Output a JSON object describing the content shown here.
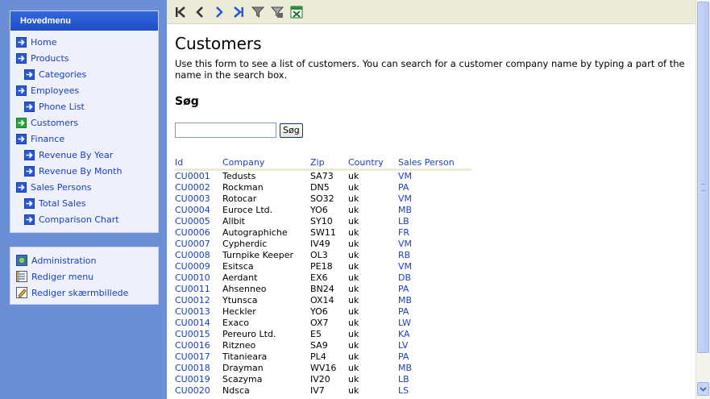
{
  "sidebar": {
    "header": "Hovedmenu",
    "menu": [
      {
        "label": "Home",
        "level": 0,
        "icon": "arrow-right-icon"
      },
      {
        "label": "Products",
        "level": 0,
        "icon": "arrow-right-icon"
      },
      {
        "label": "Categories",
        "level": 1,
        "icon": "arrow-right-icon"
      },
      {
        "label": "Employees",
        "level": 0,
        "icon": "arrow-right-icon"
      },
      {
        "label": "Phone List",
        "level": 1,
        "icon": "arrow-right-icon"
      },
      {
        "label": "Customers",
        "level": 0,
        "icon": "arrow-right-green-icon",
        "active": true
      },
      {
        "label": "Finance",
        "level": 0,
        "icon": "arrow-right-icon"
      },
      {
        "label": "Revenue By Year",
        "level": 1,
        "icon": "arrow-right-icon"
      },
      {
        "label": "Revenue By Month",
        "level": 1,
        "icon": "arrow-right-icon"
      },
      {
        "label": "Sales Persons",
        "level": 0,
        "icon": "arrow-right-icon"
      },
      {
        "label": "Total Sales",
        "level": 1,
        "icon": "arrow-right-icon"
      },
      {
        "label": "Comparison Chart",
        "level": 1,
        "icon": "arrow-right-icon"
      }
    ],
    "admin": [
      {
        "label": "Administration",
        "icon": "administration-icon"
      },
      {
        "label": "Rediger menu",
        "icon": "edit-menu-icon"
      },
      {
        "label": "Rediger skærmbillede",
        "icon": "edit-screen-icon"
      }
    ]
  },
  "toolbar": {
    "buttons": [
      "first-page-icon",
      "previous-page-icon",
      "next-page-icon",
      "last-page-icon",
      "filter-icon",
      "clear-filter-icon",
      "excel-export-icon"
    ]
  },
  "page": {
    "title": "Customers",
    "description": "Use this form to see a list of customers. You can search for a customer company name by typing a part of the name in the search box.",
    "search_heading": "Søg",
    "search_value": "",
    "search_button": "Søg"
  },
  "table": {
    "headers": [
      "Id",
      "Company",
      "Zip",
      "Country",
      "Sales Person"
    ],
    "rows": [
      [
        "CU0001",
        "Tedusts",
        "SA73",
        "uk",
        "VM"
      ],
      [
        "CU0002",
        "Rockman",
        "DN5",
        "uk",
        "PA"
      ],
      [
        "CU0003",
        "Rotocar",
        "SO32",
        "uk",
        "VM"
      ],
      [
        "CU0004",
        "Eurocе Ltd.",
        "YO6",
        "uk",
        "MB"
      ],
      [
        "CU0005",
        "Allbit",
        "SY10",
        "uk",
        "LB"
      ],
      [
        "CU0006",
        "Autographiche",
        "SW11",
        "uk",
        "FR"
      ],
      [
        "CU0007",
        "Cypherdic",
        "IV49",
        "uk",
        "VM"
      ],
      [
        "CU0008",
        "Turnpike Keeper",
        "OL3",
        "uk",
        "RB"
      ],
      [
        "CU0009",
        "Esitsca",
        "PE18",
        "uk",
        "VM"
      ],
      [
        "CU0010",
        "Aerdant",
        "EX6",
        "uk",
        "DB"
      ],
      [
        "CU0011",
        "Ahsenneo",
        "BN24",
        "uk",
        "PA"
      ],
      [
        "CU0012",
        "Ytunsca",
        "OX14",
        "uk",
        "MB"
      ],
      [
        "CU0013",
        "Heckler",
        "YO6",
        "uk",
        "PA"
      ],
      [
        "CU0014",
        "Exaco",
        "OX7",
        "uk",
        "LW"
      ],
      [
        "CU0015",
        "Pereuro Ltd.",
        "E5",
        "uk",
        "KA"
      ],
      [
        "CU0016",
        "Ritzneo",
        "SA9",
        "uk",
        "LV"
      ],
      [
        "CU0017",
        "Titanieara",
        "PL4",
        "uk",
        "PA"
      ],
      [
        "CU0018",
        "Drayman",
        "WV16",
        "uk",
        "MB"
      ],
      [
        "CU0019",
        "Scazyma",
        "IV20",
        "uk",
        "LB"
      ],
      [
        "CU0020",
        "Ndsca",
        "IV7",
        "uk",
        "LS"
      ]
    ]
  }
}
